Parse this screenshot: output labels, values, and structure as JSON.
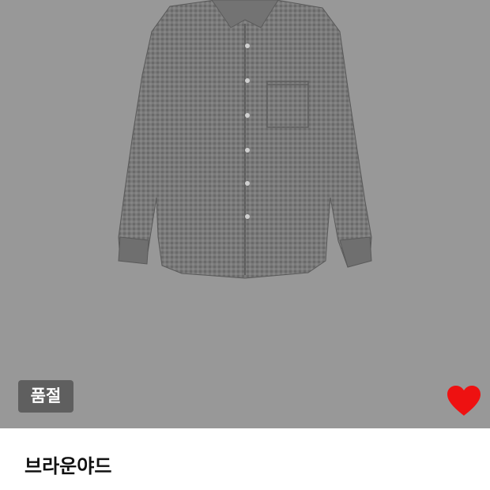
{
  "product": {
    "badge": "품절",
    "brand": "브라운야드",
    "wished": true
  },
  "colors": {
    "image_background": "#989898",
    "badge_background": "#5f5f5f",
    "heart": "#ee1111"
  },
  "icons": {
    "wish": "heart-icon"
  }
}
